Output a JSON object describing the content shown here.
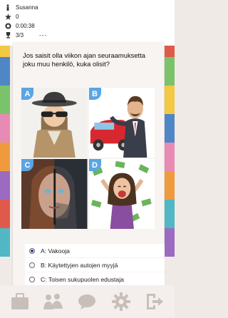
{
  "status": {
    "player_name": "Susanna",
    "score": "0",
    "time": "0:00:38",
    "progress": "3/3",
    "streak": "---"
  },
  "question": {
    "text": "Jos saisit olla viikon ajan seuraamuksetta joku muu henkilö, kuka olisit?"
  },
  "images": [
    {
      "letter": "A",
      "icon": "spy-in-trench-coat-image"
    },
    {
      "letter": "B",
      "icon": "car-salesman-image"
    },
    {
      "letter": "C",
      "icon": "split-gender-face-image"
    },
    {
      "letter": "D",
      "icon": "woman-with-money-image"
    }
  ],
  "answers": [
    {
      "label": "A: Vakooja",
      "selected": true
    },
    {
      "label": "B: Käytettyjen autojen myyjä",
      "selected": false
    },
    {
      "label": "C: Toisen sukupuolen edustaja",
      "selected": false
    }
  ],
  "nav": [
    "briefcase-icon",
    "people-icon",
    "chat-icon",
    "gear-icon",
    "exit-icon"
  ],
  "colors": {
    "badge": "#5aa5e3",
    "radio_selected": "#2d3bb5",
    "nav_icon": "#c8bfb9"
  }
}
